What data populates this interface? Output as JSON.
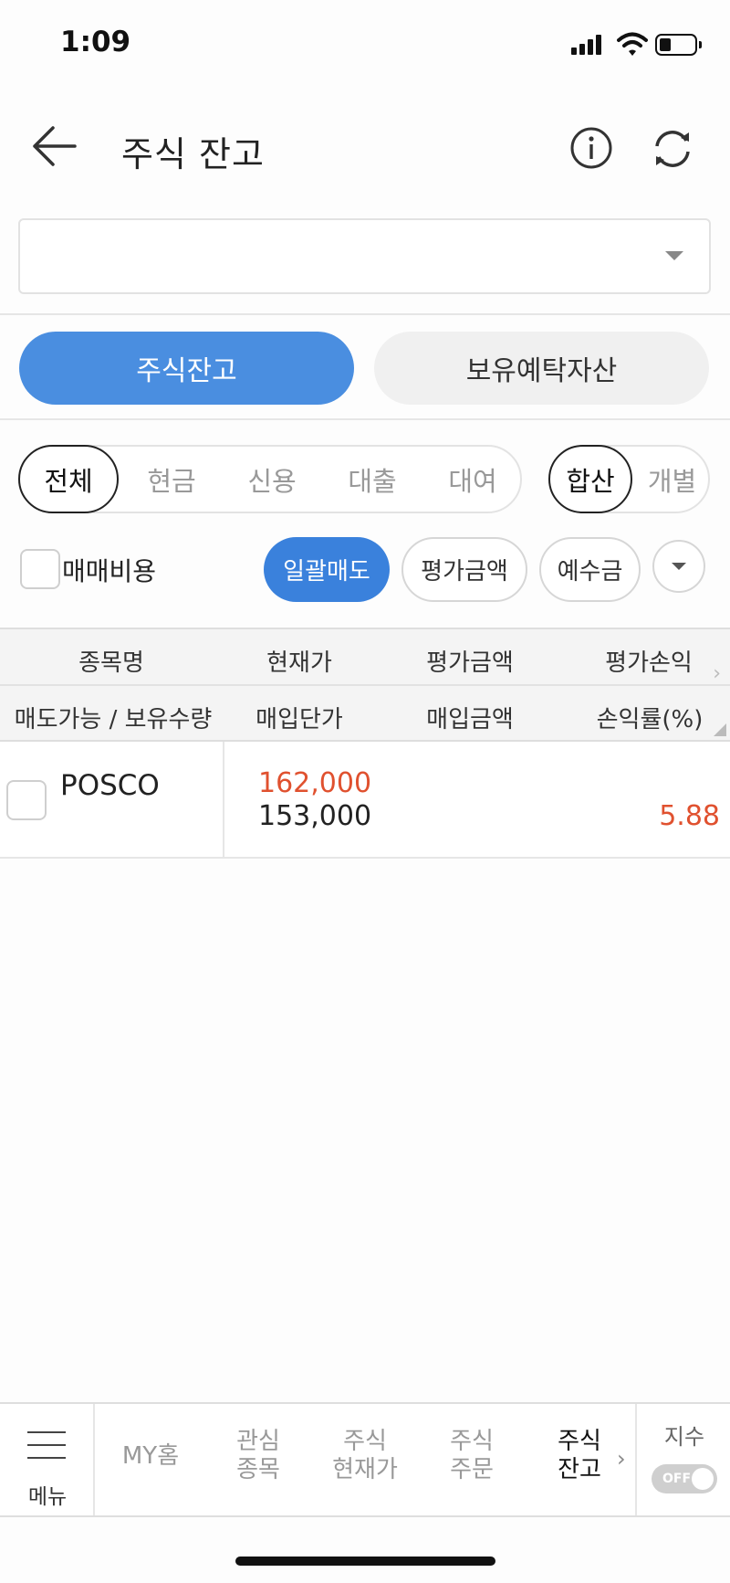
{
  "status_bar": {
    "time": "1:09"
  },
  "header": {
    "title": "주식 잔고"
  },
  "account_select": {
    "value": ""
  },
  "main_tabs": [
    {
      "label": "주식잔고",
      "active": true
    },
    {
      "label": "보유예탁자산",
      "active": false
    }
  ],
  "type_filter": {
    "items": [
      "전체",
      "현금",
      "신용",
      "대출",
      "대여"
    ],
    "selected": "전체"
  },
  "view_filter": {
    "items": [
      "합산",
      "개별"
    ],
    "selected": "합산"
  },
  "options": {
    "fee_label": "매매비용",
    "bulk_sell": "일괄매도",
    "eval_amount": "평가금액",
    "deposit": "예수금"
  },
  "table": {
    "headers_row1": [
      "종목명",
      "현재가",
      "평가금액",
      "평가손익"
    ],
    "headers_row2": [
      "매도가능 / 보유수량",
      "매입단가",
      "매입금액",
      "손익률(%)"
    ],
    "rows": [
      {
        "name": "POSCO",
        "current_price": "162,000",
        "buy_price": "153,000",
        "eval_amount": "",
        "buy_amount": "",
        "pl_amount": "",
        "pl_rate": "5.88"
      }
    ]
  },
  "bottom_nav": {
    "menu": "메뉴",
    "items": [
      {
        "line1": "MY홈",
        "line2": ""
      },
      {
        "line1": "관심",
        "line2": "종목"
      },
      {
        "line1": "주식",
        "line2": "현재가"
      },
      {
        "line1": "주식",
        "line2": "주문"
      },
      {
        "line1": "주식",
        "line2": "잔고",
        "current": true
      }
    ],
    "index_label": "지수",
    "index_toggle": "OFF"
  },
  "colors": {
    "accent": "#4a8ee0",
    "up": "#e0512f"
  }
}
